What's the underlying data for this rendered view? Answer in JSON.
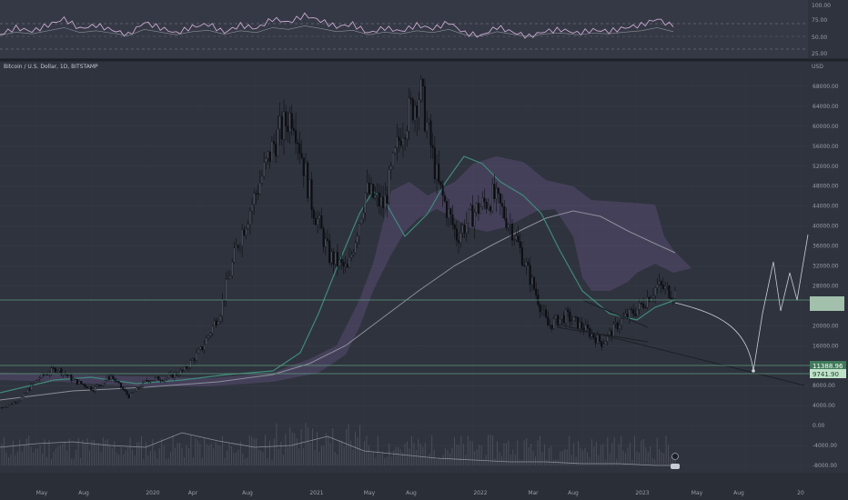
{
  "header": {
    "symbol_title": "Bitcoin / U.S. Dollar, 1D, BITSTAMP",
    "currency": "USD"
  },
  "colors": {
    "background": "#2f333d",
    "panel": "#3a3e49",
    "candle": "#0c0e13",
    "ema_fast": "#3f8a7c",
    "ma_slow": "#8b8f99",
    "cloud": "#6a5a88",
    "rsi": "#c9a9d0",
    "price_tag_green": "#3f7a5a",
    "price_tag_light": "#bfe3c8"
  },
  "chart_data": [
    {
      "type": "line",
      "title": "",
      "name": "rsi-panel",
      "ylim": [
        0,
        110
      ],
      "yticks": [
        "100.00",
        "75.00",
        "50.00",
        "25.00"
      ],
      "levels": [
        70,
        50,
        30
      ],
      "series": [
        {
          "name": "",
          "x": [
            0.0,
            0.02,
            0.04,
            0.06,
            0.08,
            0.1,
            0.12,
            0.14,
            0.16,
            0.18,
            0.2,
            0.22,
            0.24,
            0.26,
            0.28,
            0.3,
            0.32,
            0.34,
            0.36,
            0.38,
            0.4,
            0.42,
            0.44,
            0.46,
            0.48,
            0.5,
            0.52,
            0.54,
            0.56,
            0.58,
            0.6,
            0.62,
            0.64,
            0.66,
            0.68,
            0.7,
            0.72,
            0.74,
            0.76,
            0.78,
            0.8,
            0.82,
            0.84
          ],
          "values": [
            45,
            60,
            52,
            66,
            80,
            58,
            66,
            55,
            44,
            72,
            60,
            48,
            62,
            68,
            50,
            66,
            58,
            80,
            72,
            88,
            76,
            62,
            68,
            48,
            60,
            52,
            66,
            58,
            72,
            48,
            42,
            62,
            50,
            40,
            52,
            56,
            48,
            55,
            52,
            60,
            66,
            80,
            62
          ]
        }
      ]
    },
    {
      "type": "candlestick",
      "title": "Bitcoin / U.S. Dollar, 1D, BITSTAMP",
      "ylabel": "USD",
      "ylim": [
        -8000,
        70000
      ],
      "yticks": [
        "68000.00",
        "64000.00",
        "60000.00",
        "56000.00",
        "52000.00",
        "48000.00",
        "44000.00",
        "40000.00",
        "36000.00",
        "32000.00",
        "28000.00",
        "20000.00",
        "16000.00",
        "8000.00",
        "4000.00",
        "0.00",
        "-4000.00",
        "-8000.00"
      ],
      "xticks": [
        "May",
        "Aug",
        "2020",
        "Apr",
        "Aug",
        "2021",
        "May",
        "Aug",
        "2022",
        "Mar",
        "Aug",
        "2023",
        "May",
        "Aug",
        "20"
      ],
      "price_labels": [
        "11388.96",
        "9741.90"
      ],
      "series": [
        {
          "name": "",
          "x": [
            "2019-02",
            "2019-04",
            "2019-06",
            "2019-08",
            "2019-10",
            "2019-12",
            "2020-02",
            "2020-03",
            "2020-05",
            "2020-07",
            "2020-09",
            "2020-11",
            "2020-12",
            "2021-01",
            "2021-02",
            "2021-03",
            "2021-04",
            "2021-05",
            "2021-06",
            "2021-07",
            "2021-08",
            "2021-09",
            "2021-10",
            "2021-11",
            "2021-12",
            "2022-01",
            "2022-02",
            "2022-03",
            "2022-04",
            "2022-05",
            "2022-06",
            "2022-08",
            "2022-10",
            "2022-12",
            "2023-01",
            "2023-02",
            "2023-03",
            "2023-04"
          ],
          "values": [
            3600,
            5200,
            9500,
            11500,
            9000,
            7300,
            9900,
            5800,
            9200,
            9500,
            11000,
            15500,
            23000,
            37000,
            47000,
            57000,
            63000,
            45000,
            34000,
            31000,
            47000,
            44000,
            60000,
            67000,
            48000,
            38000,
            43000,
            46000,
            40000,
            30000,
            20000,
            22000,
            19500,
            16500,
            21000,
            23500,
            28000,
            26500
          ]
        }
      ]
    }
  ]
}
